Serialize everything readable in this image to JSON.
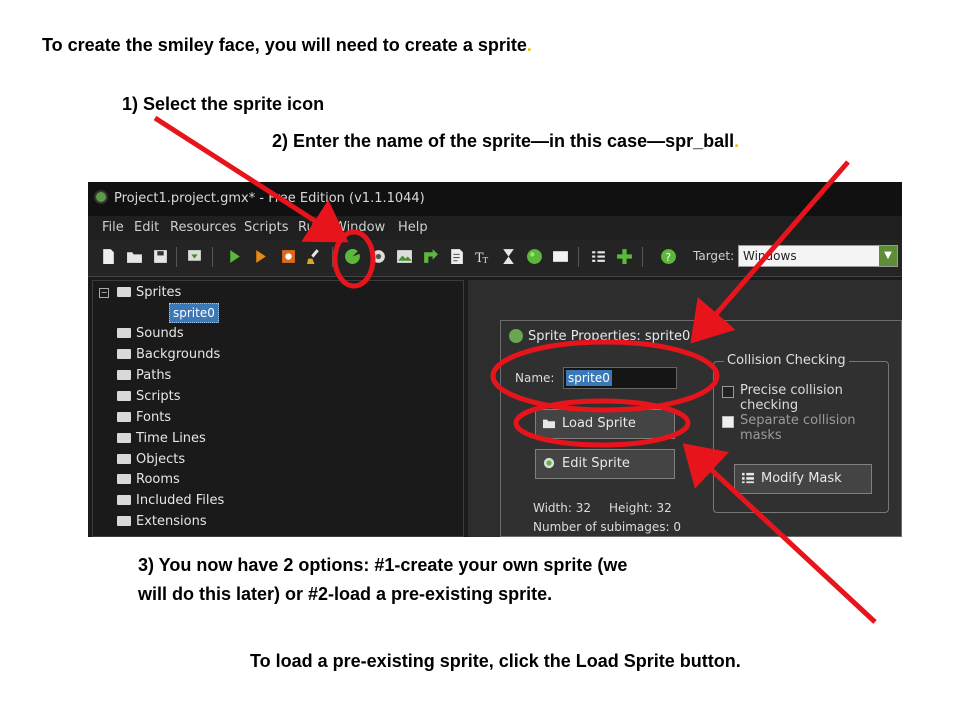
{
  "captions": {
    "intro": "To create the smiley face, you will need to create a sprite",
    "intro_dot": ".",
    "step1": "1) Select the sprite icon",
    "step2": "2) Enter the name of the sprite—in this case—spr_ball",
    "step2_dot": ".",
    "step3_line1": "3) You now have 2 options: #1-create your own sprite (we",
    "step3_line2": "will do this later) or #2-load a pre-existing sprite.",
    "final": "To load a pre-existing sprite, click the Load Sprite button."
  },
  "window": {
    "title": "Project1.project.gmx* - Free Edition (v1.1.1044)"
  },
  "menu": [
    "File",
    "Edit",
    "Resources",
    "Scripts",
    "Run",
    "Window",
    "Help"
  ],
  "toolbar": {
    "icons": [
      "new-icon",
      "open-icon",
      "save-icon",
      "export-icon",
      "run-icon",
      "debug-icon",
      "stop-icon",
      "clean-icon",
      "sprite-icon",
      "sound-icon",
      "background-icon",
      "path-icon",
      "script-icon",
      "font-icon",
      "timeline-icon",
      "object-icon",
      "room-icon",
      "settings-icon",
      "add-icon",
      "help-icon"
    ],
    "target_label": "Target:",
    "target_value": "Windows"
  },
  "tree": {
    "root": "Sprites",
    "selected_child": "sprite0",
    "folders": [
      "Sounds",
      "Backgrounds",
      "Paths",
      "Scripts",
      "Fonts",
      "Time Lines",
      "Objects",
      "Rooms",
      "Included Files",
      "Extensions"
    ]
  },
  "dialog": {
    "title": "Sprite Properties: sprite0",
    "name_label": "Name:",
    "name_value": "sprite0",
    "load_button": "Load Sprite",
    "edit_button": "Edit Sprite",
    "width_label": "Width: 32",
    "height_label": "Height: 32",
    "subimages_label": "Number of subimages: 0",
    "collision": {
      "title": "Collision Checking",
      "precise": "Precise collision checking",
      "separate": "Separate collision masks",
      "modify_mask": "Modify Mask"
    }
  },
  "colors": {
    "annotation_red": "#e8141c",
    "caption_dot": "#e8c21a",
    "selection_blue": "#3b78b8",
    "ide_dark": "#1b1b1b"
  }
}
